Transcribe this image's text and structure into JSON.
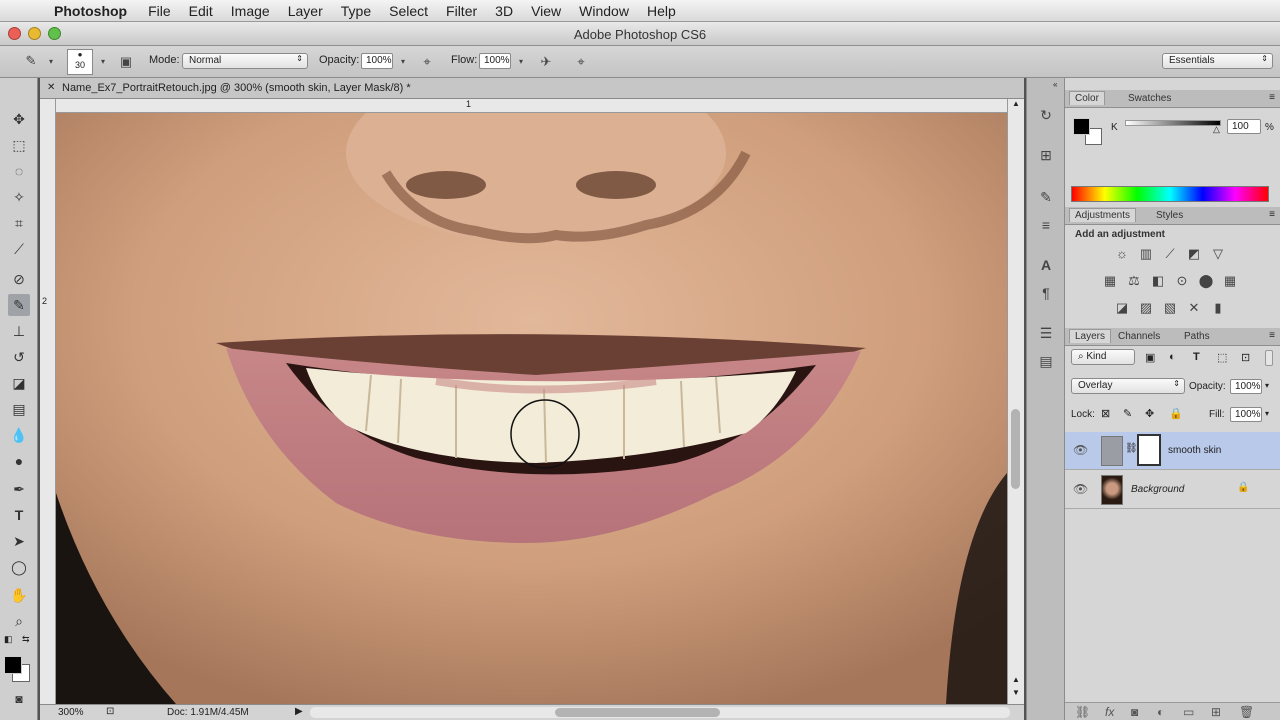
{
  "menubar": {
    "app": "Photoshop",
    "items": [
      "File",
      "Edit",
      "Image",
      "Layer",
      "Type",
      "Select",
      "Filter",
      "3D",
      "View",
      "Window",
      "Help"
    ]
  },
  "window": {
    "title": "Adobe Photoshop CS6"
  },
  "options": {
    "brush_size": "30",
    "mode_label": "Mode:",
    "mode_value": "Normal",
    "opacity_label": "Opacity:",
    "opacity_value": "100%",
    "flow_label": "Flow:",
    "flow_value": "100%",
    "workspace": "Essentials"
  },
  "document": {
    "tab_title": "Name_Ex7_PortraitRetouch.jpg @ 300% (smooth skin, Layer Mask/8) *",
    "ruler_h_mark": "1",
    "ruler_v_mark": "2",
    "zoom": "300%",
    "doc_info": "Doc: 1.91M/4.45M"
  },
  "color_panel": {
    "tabs": [
      "Color",
      "Swatches"
    ],
    "channel": "K",
    "value": "100",
    "unit": "%"
  },
  "adjustments_panel": {
    "tabs": [
      "Adjustments",
      "Styles"
    ],
    "heading": "Add an adjustment"
  },
  "layers_panel": {
    "tabs": [
      "Layers",
      "Channels",
      "Paths"
    ],
    "filter_kind": "Kind",
    "blend_mode": "Overlay",
    "opacity_label": "Opacity:",
    "opacity_value": "100%",
    "lock_label": "Lock:",
    "fill_label": "Fill:",
    "fill_value": "100%",
    "layers": [
      {
        "name": "smooth skin",
        "selected": true
      },
      {
        "name": "Background",
        "selected": false
      }
    ]
  },
  "colors": {
    "selection": "#b9c9ea",
    "panel": "#d6d6d6",
    "toolbar": "#cfcfcf"
  }
}
